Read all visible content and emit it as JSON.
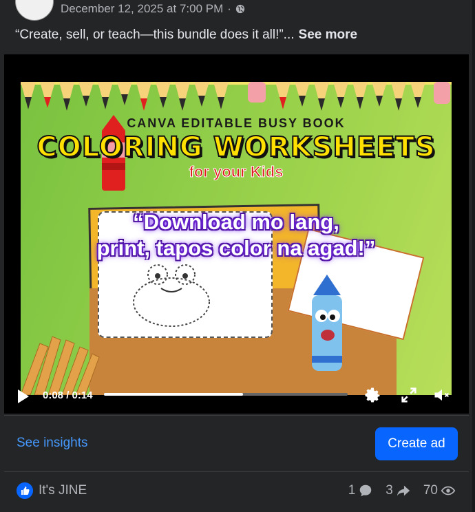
{
  "post": {
    "timestamp": "December 12, 2025 at 7:00 PM",
    "separator": "·",
    "caption": "“Create, sell, or teach—this bundle does it all!”...",
    "see_more_label": "See more"
  },
  "video": {
    "title_top": "CANVA EDITABLE BUSY BOOK",
    "title_main": "COLORING WORKSHEETS",
    "title_sub": "for your Kids",
    "overlay_quote_line1": "“Download mo lang,",
    "overlay_quote_line2": "print, tapos color na agad!”",
    "time_display": "0:08 / 0:14",
    "progress": 0.57
  },
  "actions": {
    "insights_label": "See insights",
    "create_ad_label": "Create ad"
  },
  "engagement": {
    "reaction_by": "It's JINE",
    "comments_count": "1",
    "shares_count": "3",
    "views_count": "70"
  },
  "colors": {
    "background": "#242526",
    "link_blue": "#4599ff",
    "primary_button": "#0866ff"
  }
}
